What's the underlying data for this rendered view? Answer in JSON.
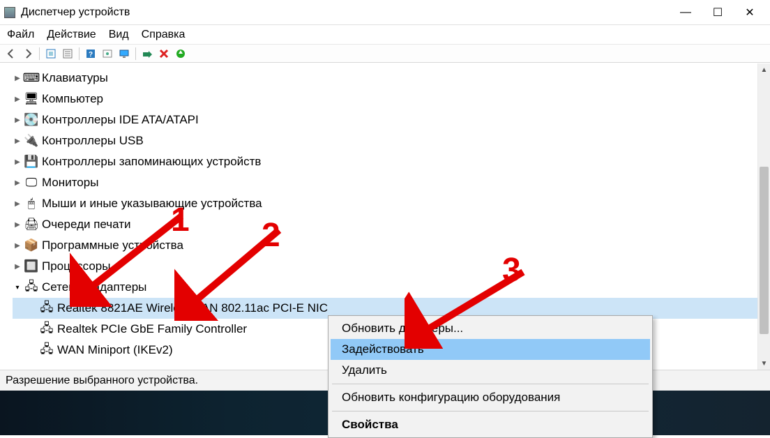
{
  "window": {
    "title": "Диспетчер устройств",
    "min": "—",
    "max": "☐",
    "close": "✕"
  },
  "menu": {
    "file": "Файл",
    "action": "Действие",
    "view": "Вид",
    "help": "Справка"
  },
  "tree": {
    "items": [
      {
        "label": "Клавиатуры",
        "expanded": false
      },
      {
        "label": "Компьютер",
        "expanded": false
      },
      {
        "label": "Контроллеры IDE ATA/ATAPI",
        "expanded": false
      },
      {
        "label": "Контроллеры USB",
        "expanded": false
      },
      {
        "label": "Контроллеры запоминающих устройств",
        "expanded": false
      },
      {
        "label": "Мониторы",
        "expanded": false
      },
      {
        "label": "Мыши и иные указывающие устройства",
        "expanded": false
      },
      {
        "label": "Очереди печати",
        "expanded": false
      },
      {
        "label": "Программные устройства",
        "expanded": false
      },
      {
        "label": "Процессоры",
        "expanded": false
      },
      {
        "label": "Сетевые адаптеры",
        "expanded": true,
        "children": [
          {
            "label": "Realtek 8821AE Wireless LAN 802.11ac PCI-E NIC",
            "selected": true
          },
          {
            "label": "Realtek PCIe GbE Family Controller",
            "selected": false
          },
          {
            "label": "WAN Miniport (IKEv2)",
            "selected": false
          }
        ]
      }
    ]
  },
  "context_menu": {
    "update": "Обновить драйверы...",
    "enable": "Задействовать",
    "delete": "Удалить",
    "scan": "Обновить конфигурацию оборудования",
    "properties": "Свойства"
  },
  "status": "Разрешение выбранного устройства.",
  "annotations": {
    "n1": "1",
    "n2": "2",
    "n3": "3"
  }
}
